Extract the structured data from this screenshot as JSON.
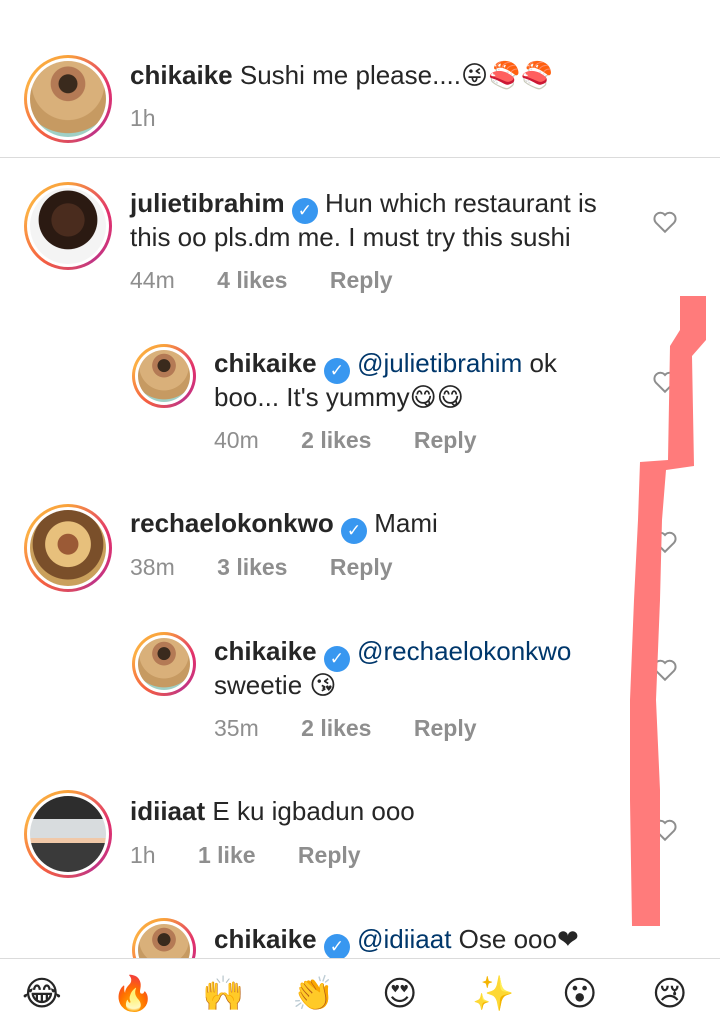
{
  "comments": [
    {
      "username": "chikaike",
      "verified": false,
      "text": "Sushi me please....😜🍣🍣",
      "time": "1h"
    },
    {
      "username": "julietibrahim",
      "verified": true,
      "text_line1": "Hun which restaurant is",
      "text_line2": "this oo pls.dm me. I must try this sushi",
      "time": "44m",
      "likes": "4 likes",
      "reply": "Reply",
      "replies": [
        {
          "username": "chikaike",
          "verified": true,
          "mention": "@julietibrahim",
          "text_after_mention": " ok",
          "text_line2": "boo... It's yummy😋😋",
          "time": "40m",
          "likes": "2 likes",
          "reply": "Reply"
        }
      ]
    },
    {
      "username": "rechaelokonkwo",
      "verified": true,
      "text": "Mami",
      "time": "38m",
      "likes": "3 likes",
      "reply": "Reply",
      "replies": [
        {
          "username": "chikaike",
          "verified": true,
          "mention": "@rechaelokonkwo",
          "text_line2": "sweetie 😘",
          "time": "35m",
          "likes": "2 likes",
          "reply": "Reply"
        }
      ]
    },
    {
      "username": "idiiaat",
      "verified": false,
      "text": "E ku igbadun ooo",
      "time": "1h",
      "likes": "1 like",
      "reply": "Reply",
      "replies": [
        {
          "username": "chikaike",
          "verified": true,
          "mention": "@idiiaat",
          "text_after_mention": " Ose ooo❤"
        }
      ]
    }
  ],
  "reaction_bar": [
    "😂",
    "🔥",
    "🙌",
    "👏",
    "😍",
    "✨",
    "😮",
    "😢"
  ],
  "icons": {
    "verified": "check-badge-icon",
    "like": "heart-outline-icon"
  },
  "colors": {
    "mention": "#00376b",
    "verified": "#3897f0",
    "meta": "#8e8e8e",
    "annotation": "#ff7b7b"
  }
}
